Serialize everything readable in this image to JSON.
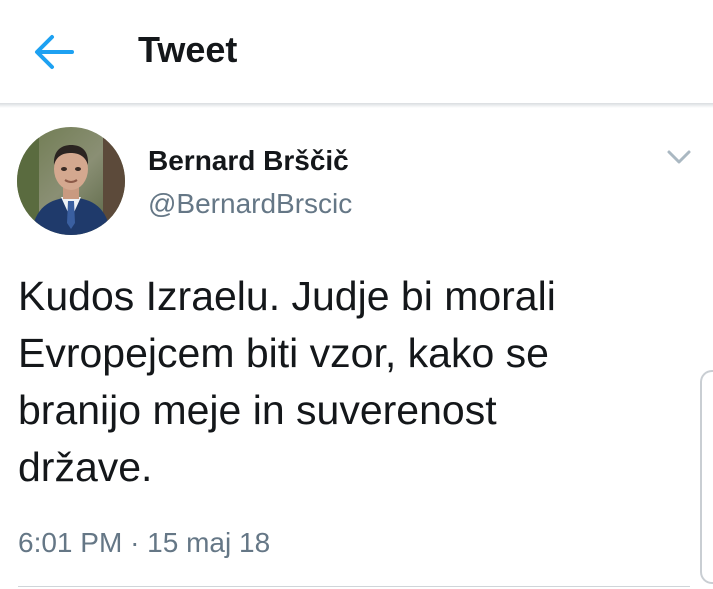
{
  "header": {
    "title": "Tweet",
    "back_icon": "arrow-left-icon",
    "accent_color": "#1da1f2"
  },
  "tweet": {
    "author": {
      "display_name": "Bernard Brščič",
      "handle": "@BernardBrscic",
      "avatar_icon": "profile-photo"
    },
    "text": "Kudos Izraelu. Judje bi morali\nEvropejcem biti vzor, kako se\nbranijo meje in suverenost\ndržave.",
    "time": "6:01 PM",
    "separator": "·",
    "date": "15 maj 18",
    "menu_icon": "chevron-down-icon"
  },
  "colors": {
    "text_primary": "#14171a",
    "text_secondary": "#657786",
    "divider": "#d0d5d9"
  }
}
